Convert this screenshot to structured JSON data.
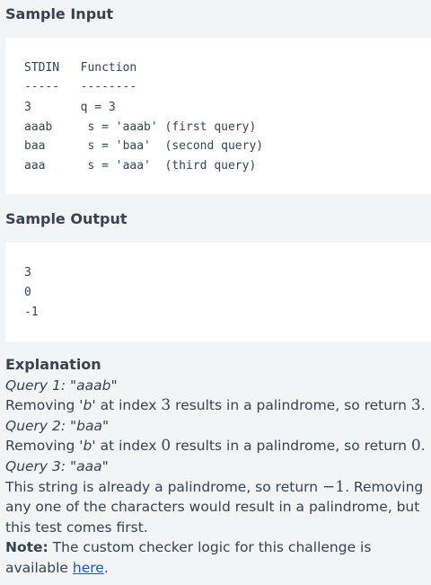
{
  "sample_input": {
    "heading": "Sample Input",
    "lines": [
      "STDIN   Function",
      "-----   --------",
      "3       q = 3",
      "aaab     s = 'aaab' (first query)",
      "baa      s = 'baa'  (second query)",
      "aaa      s = 'aaa'  (third query)"
    ]
  },
  "sample_output": {
    "heading": "Sample Output",
    "lines": [
      "3",
      "0",
      "-1"
    ]
  },
  "explanation": {
    "heading": "Explanation",
    "q1_label": "Query 1: \"aaab\"",
    "q1_text_a": "Removing ",
    "q1_char": "'b'",
    "q1_text_b": " at index ",
    "q1_index": "3",
    "q1_text_c": " results in a palindrome, so return ",
    "q1_return": "3",
    "q1_text_d": ".",
    "q2_label": "Query 2: \"baa\"",
    "q2_text_a": "Removing ",
    "q2_char": "'b'",
    "q2_text_b": " at index ",
    "q2_index": "0",
    "q2_text_c": " results in a palindrome, so return ",
    "q2_return": "0",
    "q2_text_d": ".",
    "q3_label": "Query 3: \"aaa\"",
    "q3_text_a": "This string is already a palindrome, so return ",
    "q3_return": "−1",
    "q3_text_b": ". Removing any one of the characters would result in a palindrome, but this test comes first.",
    "note_label": "Note:",
    "note_text": " The custom checker logic for this challenge is available ",
    "note_link": "here",
    "note_end": "."
  }
}
